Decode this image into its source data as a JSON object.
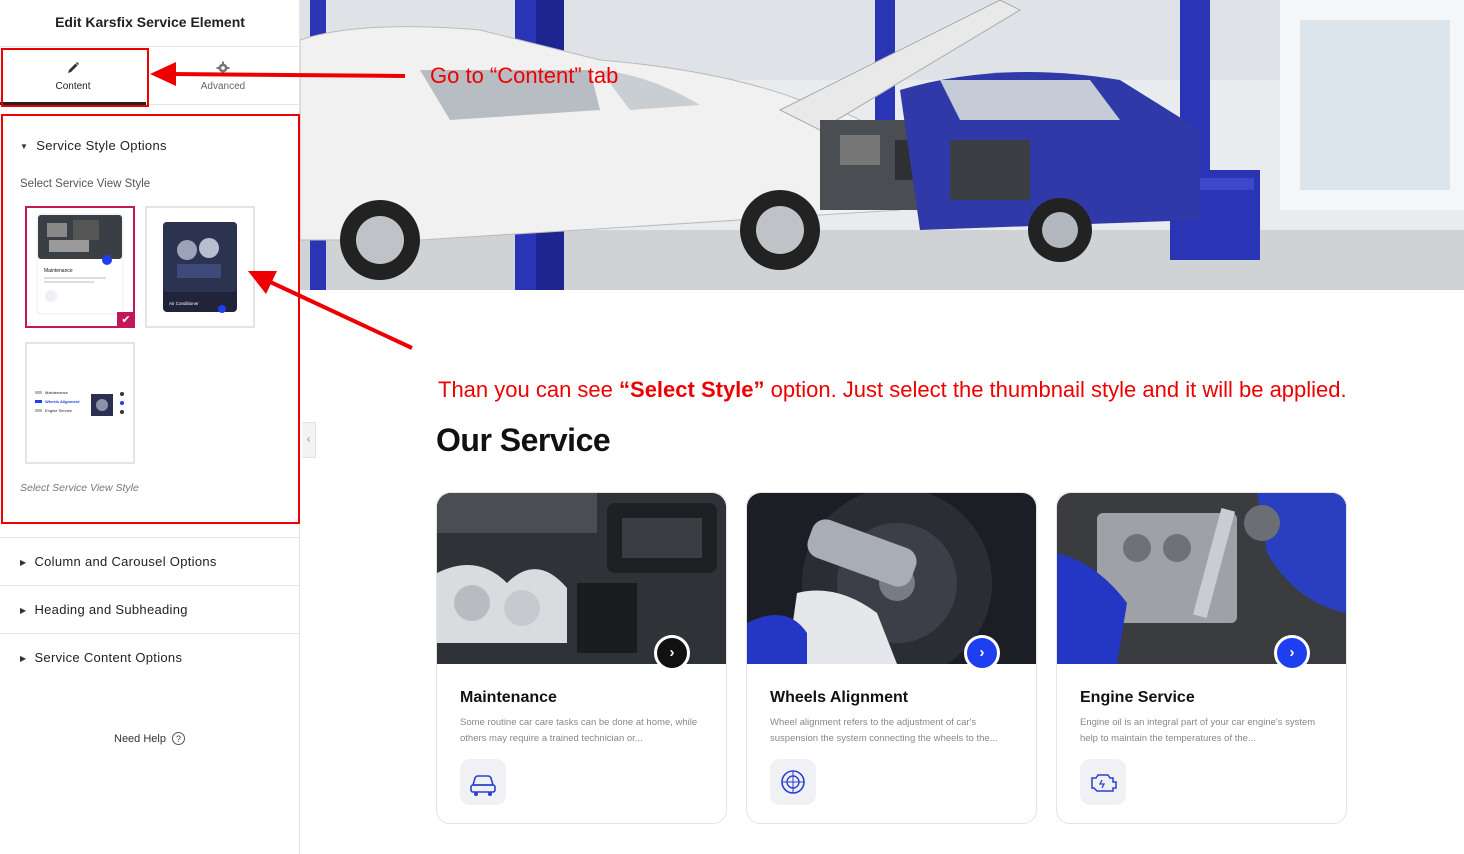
{
  "sidebar": {
    "title": "Edit Karsfix Service Element",
    "tabs": [
      {
        "label": "Content",
        "icon": "pencil-icon"
      },
      {
        "label": "Advanced",
        "icon": "gear-icon"
      }
    ],
    "service_style_section": {
      "heading": "Service Style Options",
      "select_label": "Select Service View Style",
      "hint": "Select Service View Style",
      "selected_index": 0,
      "thumbnails": [
        {
          "title": "Maintenance"
        },
        {
          "title": "Air Conditioner"
        },
        {
          "items": [
            "Maintenance",
            "Wheels Alignment",
            "Engine Service"
          ]
        }
      ]
    },
    "sections": [
      {
        "heading": "Column and Carousel Options"
      },
      {
        "heading": "Heading and Subheading"
      },
      {
        "heading": "Service Content Options"
      }
    ],
    "need_help": "Need Help"
  },
  "annotations": {
    "tab_note": "Go  to “Content” tab",
    "style_note_pre": "Than you can see ",
    "style_note_bold": "“Select Style”",
    "style_note_post": " option. Just select the thumbnail style and it will be applied."
  },
  "main": {
    "heading": "Our Service",
    "cards": [
      {
        "title": "Maintenance",
        "desc": "Some routine car care tasks can be done at home, while others may require a trained technician or...",
        "icon": "car-icon",
        "button_color": "#111111"
      },
      {
        "title": "Wheels Alignment",
        "desc": "Wheel alignment refers to the adjustment of car's suspension the system connecting the wheels to the...",
        "icon": "wheel-icon",
        "button_color": "#1d3ff0"
      },
      {
        "title": "Engine Service",
        "desc": "Engine oil is an integral part of your car engine's system help to maintain the temperatures of the...",
        "icon": "engine-icon",
        "button_color": "#1d3ff0"
      }
    ]
  },
  "colors": {
    "accent_blue": "#1d3ff0",
    "selected_pink": "#c2185b",
    "annotation_red": "#ee0000"
  }
}
